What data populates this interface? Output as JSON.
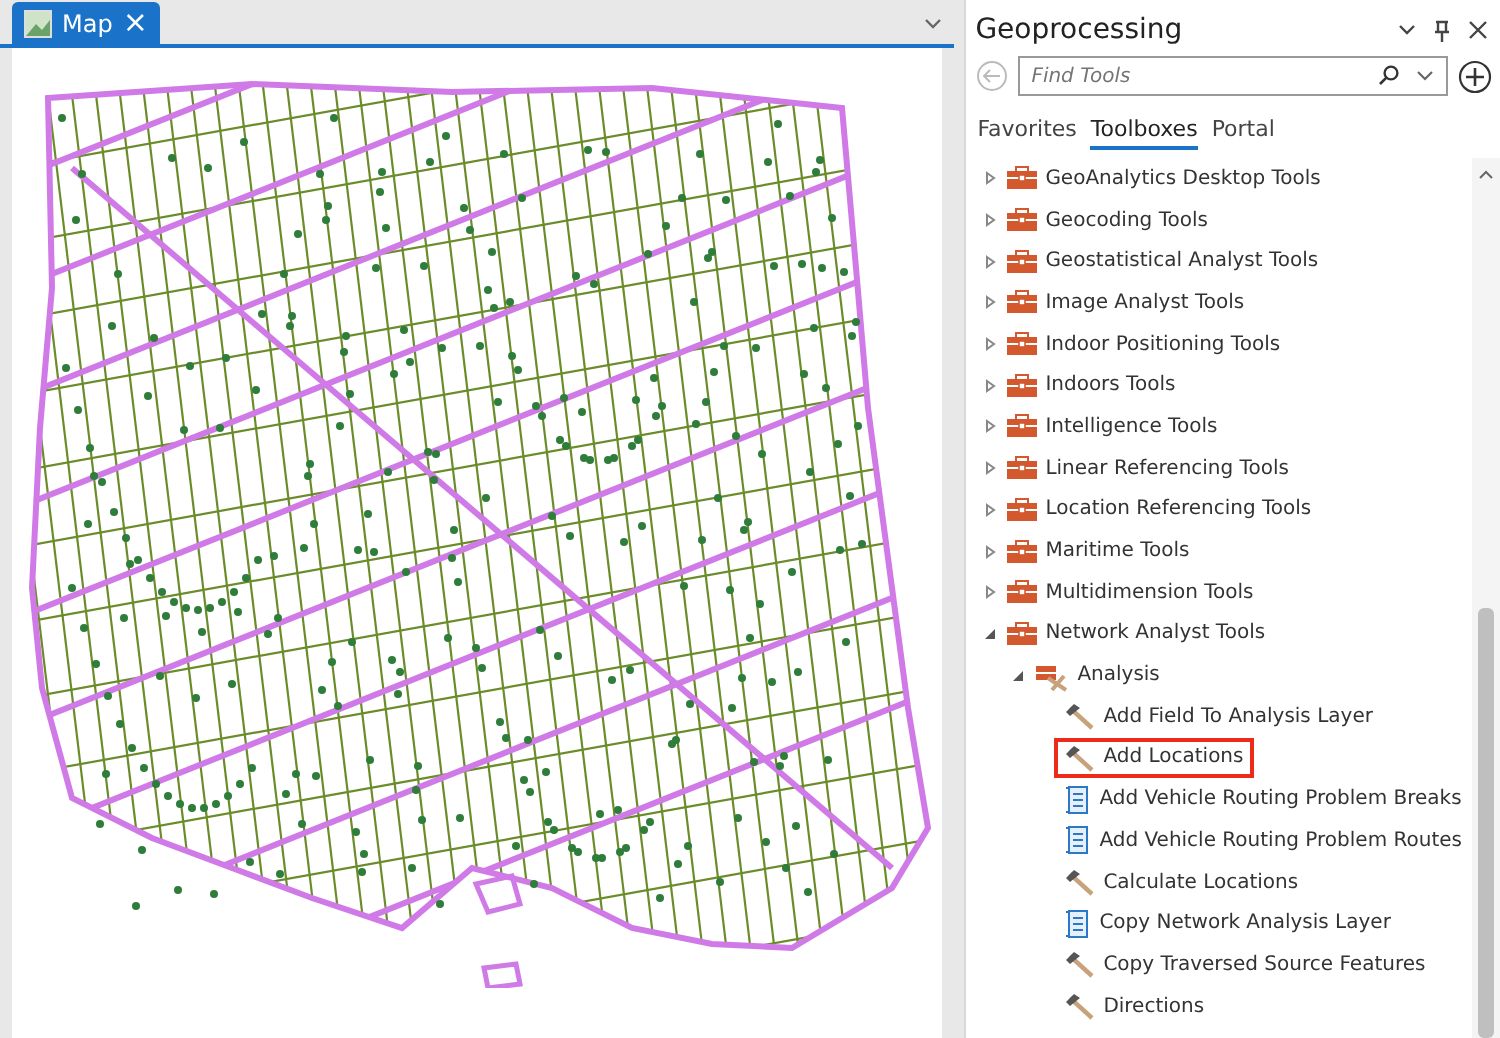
{
  "map_tab": {
    "title": "Map",
    "selected": true,
    "close": "×"
  },
  "geoprocessing": {
    "title": "Geoprocessing",
    "search": {
      "placeholder": "Find Tools"
    },
    "tabs": [
      {
        "label": "Favorites",
        "selected": false
      },
      {
        "label": "Toolboxes",
        "selected": true
      },
      {
        "label": "Portal",
        "selected": false
      }
    ],
    "toolboxes": [
      {
        "label": "GeoAnalytics Desktop Tools",
        "expanded": false
      },
      {
        "label": "Geocoding Tools",
        "expanded": false
      },
      {
        "label": "Geostatistical Analyst Tools",
        "expanded": false
      },
      {
        "label": "Image Analyst Tools",
        "expanded": false
      },
      {
        "label": "Indoor Positioning Tools",
        "expanded": false
      },
      {
        "label": "Indoors Tools",
        "expanded": false
      },
      {
        "label": "Intelligence Tools",
        "expanded": false
      },
      {
        "label": "Linear Referencing Tools",
        "expanded": false
      },
      {
        "label": "Location Referencing Tools",
        "expanded": false
      },
      {
        "label": "Maritime Tools",
        "expanded": false
      },
      {
        "label": "Multidimension Tools",
        "expanded": false
      },
      {
        "label": "Network Analyst Tools",
        "expanded": true,
        "children": [
          {
            "label": "Analysis",
            "expanded": true,
            "children": [
              {
                "label": "Add Field To Analysis Layer",
                "kind": "tool",
                "highlighted": false
              },
              {
                "label": "Add Locations",
                "kind": "tool",
                "highlighted": true
              },
              {
                "label": "Add Vehicle Routing Problem Breaks",
                "kind": "script",
                "highlighted": false
              },
              {
                "label": "Add Vehicle Routing Problem Routes",
                "kind": "script",
                "highlighted": false
              },
              {
                "label": "Calculate Locations",
                "kind": "tool",
                "highlighted": false
              },
              {
                "label": "Copy Network Analysis Layer",
                "kind": "script",
                "highlighted": false
              },
              {
                "label": "Copy Traversed Source Features",
                "kind": "tool",
                "highlighted": false
              },
              {
                "label": "Directions",
                "kind": "tool",
                "highlighted": false
              }
            ]
          }
        ]
      }
    ]
  }
}
